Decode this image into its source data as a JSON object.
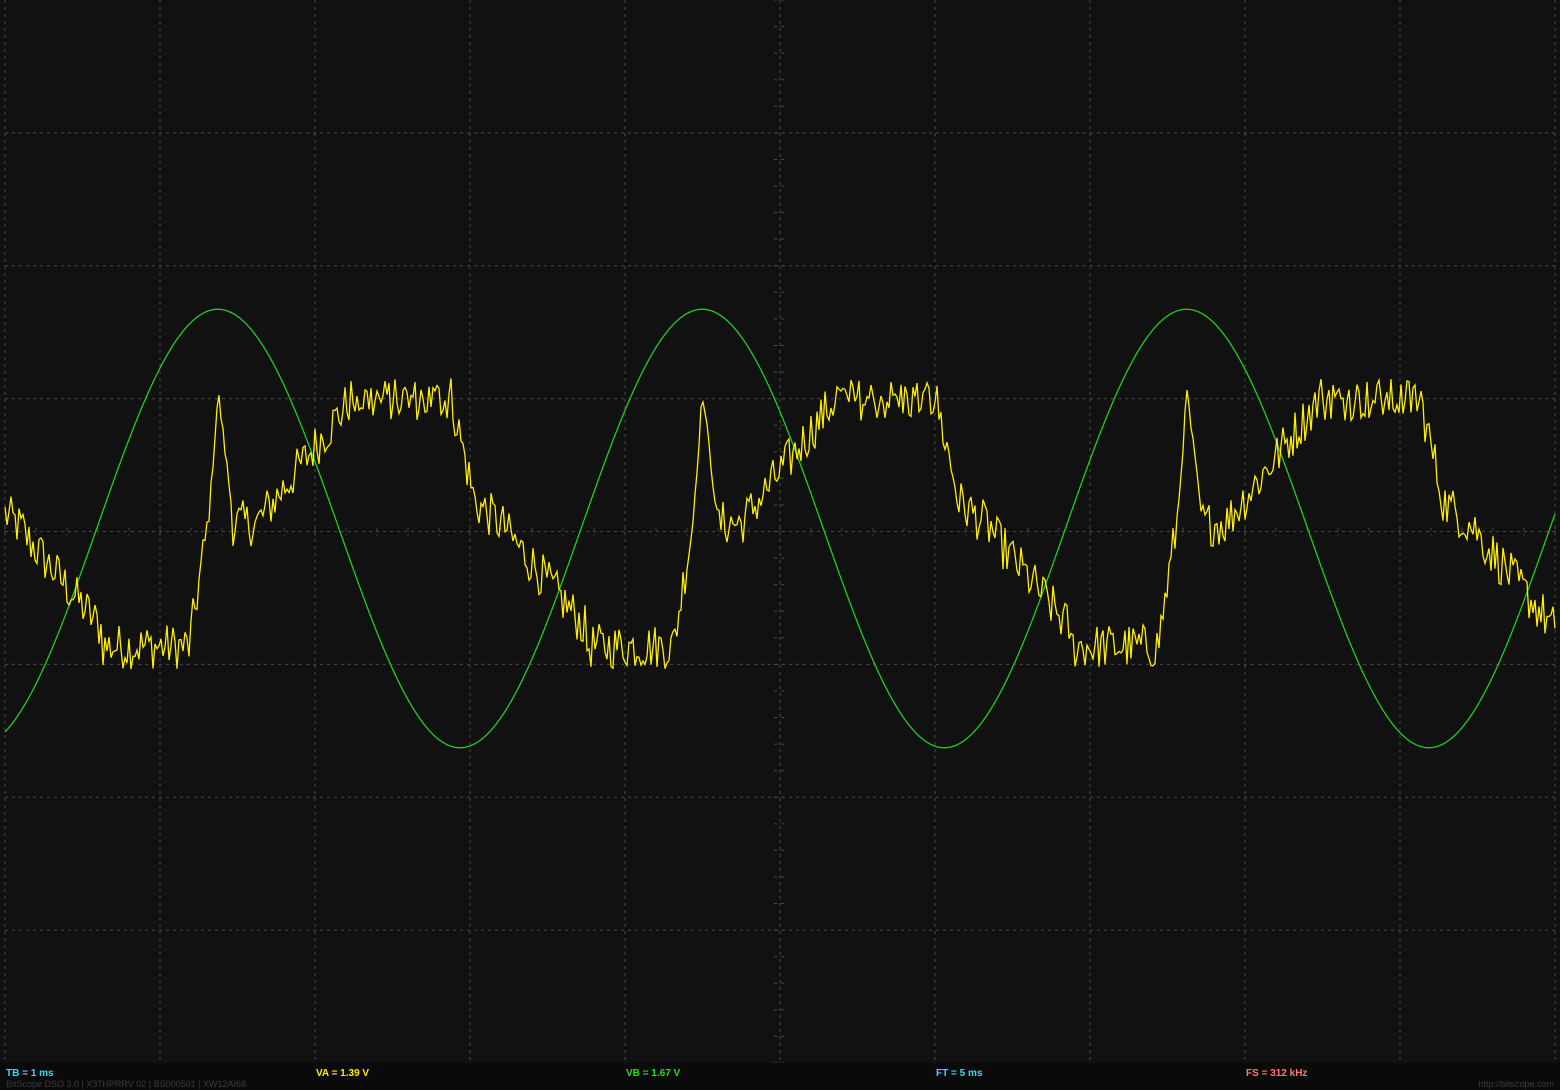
{
  "chart_data": {
    "type": "line",
    "grid": true,
    "x_unit": "ms",
    "xlim": [
      0,
      10
    ],
    "divisions": {
      "x": 10,
      "y": 8
    },
    "series": [
      {
        "channel": "A",
        "color": "#ffee00",
        "frequency_hz": 320,
        "shape": "noisy distorted wave (plateau top, sharp spike at rising edge)",
        "scale_v_per_div": 1.39
      },
      {
        "channel": "B",
        "color": "#22cc22",
        "frequency_hz": 320,
        "shape": "sine",
        "amplitude_div": 1.65,
        "scale_v_per_div": 1.67
      }
    ]
  },
  "status": {
    "tb": {
      "text": "TB = 1 ms",
      "color": "#33ddee"
    },
    "va": {
      "text": "VA = 1.39 V",
      "color": "#ffee00"
    },
    "vb": {
      "text": "VB = 1.67 V",
      "color": "#22dd22"
    },
    "ft": {
      "text": "FT = 5 ms",
      "color": "#33ddee"
    },
    "fs": {
      "text": "FS = 312 kHz",
      "color": "#ff7777"
    }
  },
  "footer": {
    "device": "BitScope DSO 3.0 | X37HPRRV 02 | BS000501 | XW12AI68",
    "url": "http://bitscope.com"
  }
}
